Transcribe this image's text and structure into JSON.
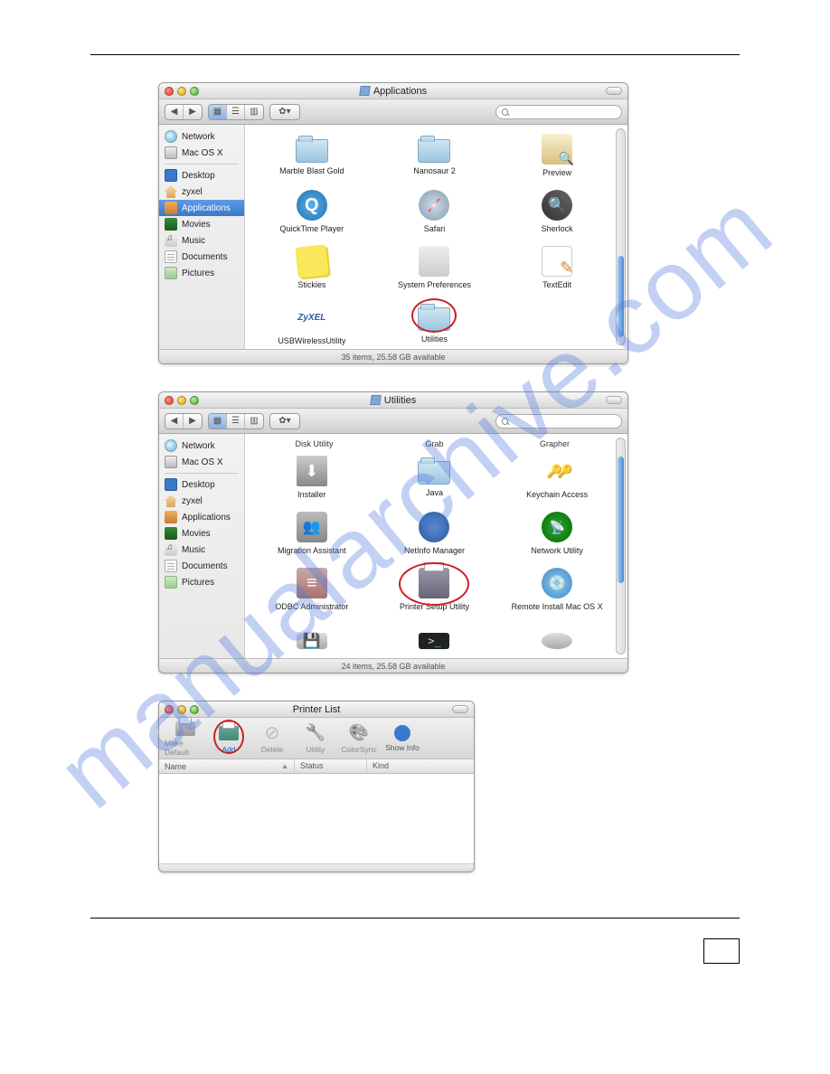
{
  "finder1": {
    "title": "Applications",
    "status": "35 items, 25.58 GB available",
    "search_placeholder": "",
    "sidebar": [
      {
        "label": "Network",
        "icon": "globe"
      },
      {
        "label": "Mac OS X",
        "icon": "hd"
      },
      {
        "sep": true
      },
      {
        "label": "Desktop",
        "icon": "desk"
      },
      {
        "label": "zyxel",
        "icon": "home"
      },
      {
        "label": "Applications",
        "icon": "apps",
        "selected": true
      },
      {
        "label": "Movies",
        "icon": "mov"
      },
      {
        "label": "Music",
        "icon": "mus"
      },
      {
        "label": "Documents",
        "icon": "doc"
      },
      {
        "label": "Pictures",
        "icon": "pic"
      }
    ],
    "items": [
      {
        "label": "Marble Blast Gold",
        "icon": "folder"
      },
      {
        "label": "Nanosaur 2",
        "icon": "folder"
      },
      {
        "label": "Preview",
        "icon": "preview"
      },
      {
        "label": "QuickTime Player",
        "icon": "qt"
      },
      {
        "label": "Safari",
        "icon": "safari"
      },
      {
        "label": "Sherlock",
        "icon": "sherlock"
      },
      {
        "label": "Stickies",
        "icon": "stickies"
      },
      {
        "label": "System Preferences",
        "icon": "sysp"
      },
      {
        "label": "TextEdit",
        "icon": "textedit"
      },
      {
        "label": "USBWirelessUtility",
        "icon": "zyxel"
      },
      {
        "label": "Utilities",
        "icon": "folder",
        "circled": true
      }
    ]
  },
  "finder2": {
    "title": "Utilities",
    "status": "24 items, 25.58 GB available",
    "sidebar": [
      {
        "label": "Network",
        "icon": "globe"
      },
      {
        "label": "Mac OS X",
        "icon": "hd"
      },
      {
        "sep": true
      },
      {
        "label": "Desktop",
        "icon": "desk"
      },
      {
        "label": "zyxel",
        "icon": "home"
      },
      {
        "label": "Applications",
        "icon": "apps"
      },
      {
        "label": "Movies",
        "icon": "mov"
      },
      {
        "label": "Music",
        "icon": "mus"
      },
      {
        "label": "Documents",
        "icon": "doc"
      },
      {
        "label": "Pictures",
        "icon": "pic"
      }
    ],
    "header_row": [
      "Disk Utility",
      "Grab",
      "Grapher"
    ],
    "items": [
      {
        "label": "Installer",
        "icon": "installer"
      },
      {
        "label": "Java",
        "icon": "folder"
      },
      {
        "label": "Keychain Access",
        "icon": "keychain"
      },
      {
        "label": "Migration Assistant",
        "icon": "migration"
      },
      {
        "label": "NetInfo Manager",
        "icon": "netinfo"
      },
      {
        "label": "Network Utility",
        "icon": "netutil"
      },
      {
        "label": "ODBC Administrator",
        "icon": "odbc"
      },
      {
        "label": "Printer Setup Utility",
        "icon": "printer",
        "circled": true
      },
      {
        "label": "Remote Install Mac OS X",
        "icon": "remote"
      },
      {
        "label": "",
        "icon": "diskutil"
      },
      {
        "label": "",
        "icon": "terminal"
      },
      {
        "label": "",
        "icon": "voiceover"
      }
    ]
  },
  "printerlist": {
    "title": "Printer List",
    "toolbar": [
      {
        "label": "Make Default",
        "icon": "print",
        "enabled": false
      },
      {
        "label": "Add",
        "icon": "print",
        "enabled": true,
        "circled": true
      },
      {
        "label": "Delete",
        "icon": "del",
        "enabled": false
      },
      {
        "label": "Utility",
        "icon": "util",
        "enabled": false
      },
      {
        "label": "ColorSync",
        "icon": "cs",
        "enabled": false
      },
      {
        "label": "Show Info",
        "icon": "info",
        "enabled": true
      }
    ],
    "columns": [
      "Name",
      "Status",
      "Kind"
    ]
  },
  "zyxel_logo": "ZyXEL"
}
